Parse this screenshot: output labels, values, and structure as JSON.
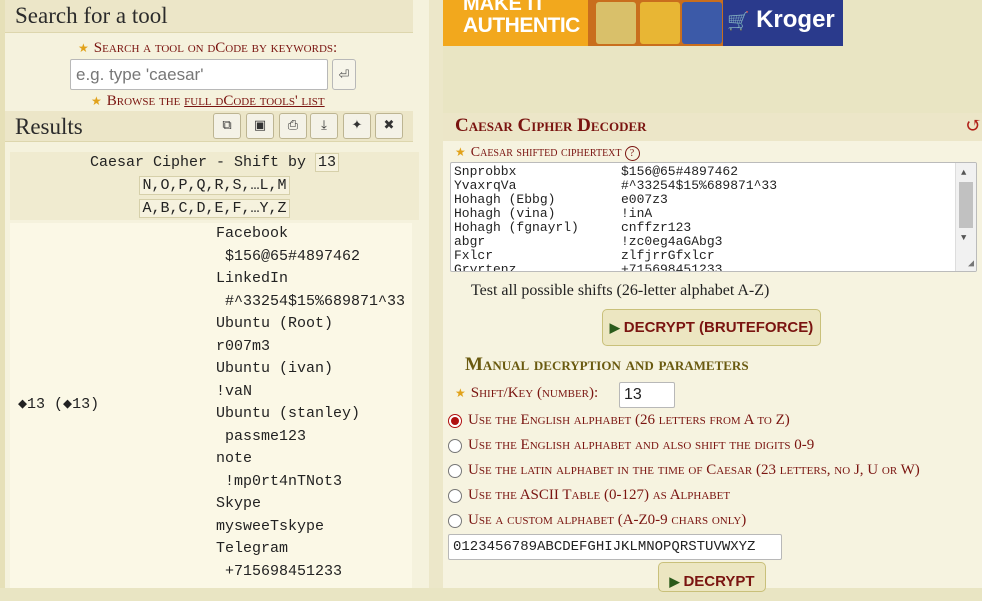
{
  "search": {
    "title": "Search for a tool",
    "prompt_label": "Search a tool on dCode by keywords:",
    "placeholder": "e.g. type 'caesar'",
    "go_icon": "return-arrow-icon",
    "browse_prefix": "Browse the ",
    "browse_link": "full dCode tools' list"
  },
  "results": {
    "title": "Results",
    "toolbar": [
      "copy-icon",
      "screenshot-icon",
      "print-icon",
      "download-icon",
      "pin-icon",
      "close-icon"
    ],
    "header_prefix": "Caesar Cipher - Shift by ",
    "shift_value": "13",
    "alphabet_shifted": "N,O,P,Q,R,S,…L,M",
    "alphabet_plain": "A,B,C,D,E,F,…Y,Z",
    "key_label": "◆13 (◆13)",
    "lines": [
      {
        "text": "Facebook",
        "sub": false
      },
      {
        "text": "$156@65#4897462",
        "sub": true
      },
      {
        "text": "LinkedIn",
        "sub": false
      },
      {
        "text": "#^33254$15%689871^33",
        "sub": true
      },
      {
        "text": "Ubuntu (Root)",
        "sub": false
      },
      {
        "text": "r007m3",
        "sub": false
      },
      {
        "text": "Ubuntu (ivan)",
        "sub": false
      },
      {
        "text": "!vaN",
        "sub": false
      },
      {
        "text": "Ubuntu (stanley)",
        "sub": false
      },
      {
        "text": "passme123",
        "sub": true
      },
      {
        "text": "note",
        "sub": false
      },
      {
        "text": "!mp0rt4nTNot3",
        "sub": true
      },
      {
        "text": "Skype",
        "sub": false
      },
      {
        "text": "mysweeTskype",
        "sub": false
      },
      {
        "text": "Telegram",
        "sub": false
      },
      {
        "text": "+715698451233",
        "sub": true
      }
    ]
  },
  "ad": {
    "line1": "MAKE IT",
    "line2": "AUTHENTIC",
    "brand": "Kroger"
  },
  "tool": {
    "title": "Caesar Cipher Decoder",
    "refresh_icon": "refresh-icon",
    "ciphertext_label": "Caesar shifted ciphertext",
    "help_icon": "?",
    "ciphertext_rows": [
      [
        "Snprobbx",
        "$156@65#4897462"
      ],
      [
        "YvaxrqVa",
        "#^33254$15%689871^33"
      ],
      [
        "Hohagh (Ebbg)",
        "e007z3"
      ],
      [
        "Hohagh (vina)",
        "!inA"
      ],
      [
        "Hohagh (fgnayrl)",
        "cnffzr123"
      ],
      [
        "abgr",
        "!zc0eg4aGAbg3"
      ],
      [
        "Fxlcr",
        "zlfjrrGfxlcr"
      ],
      [
        "Gryrtenz",
        "+715698451233"
      ]
    ],
    "test_all_label": "Test all possible shifts (26-letter alphabet A-Z)",
    "bruteforce_button": "DECRYPT (BRUTEFORCE)",
    "manual_title": "Manual decryption and parameters",
    "shift_label": "Shift/Key (number):",
    "shift_value": "13",
    "alphabet_options": [
      {
        "label": "Use the English alphabet (26 letters from A to Z)",
        "selected": true
      },
      {
        "label": "Use the English alphabet and also shift the digits 0-9",
        "selected": false
      },
      {
        "label": "Use the latin alphabet in the time of Caesar (23 letters, no J, U or W)",
        "selected": false
      },
      {
        "label": "Use the ASCII Table (0-127) as Alphabet",
        "selected": false
      },
      {
        "label": "Use a custom alphabet (A-Z0-9 chars only)",
        "selected": false
      }
    ],
    "custom_alphabet": "0123456789ABCDEFGHIJKLMNOPQRSTUVWXYZ",
    "decrypt_button": "DECRYPT"
  },
  "colors": {
    "accent": "#7a1410",
    "panel_bg": "#f5f2dd",
    "header_bg": "#ece6c8",
    "star": "#e1a21a"
  }
}
